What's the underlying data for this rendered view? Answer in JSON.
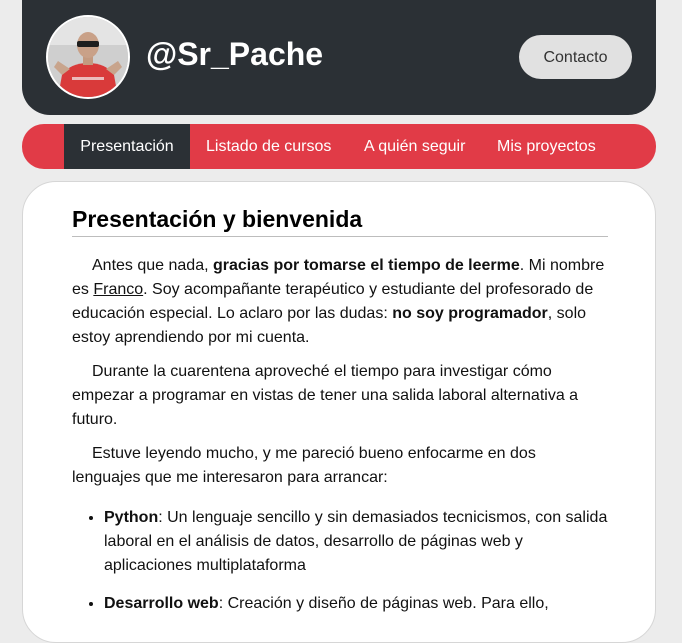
{
  "header": {
    "handle": "@Sr_Pache",
    "contact_label": "Contacto"
  },
  "nav": {
    "items": [
      {
        "label": "Presentación",
        "active": true
      },
      {
        "label": "Listado de cursos",
        "active": false
      },
      {
        "label": "A quién seguir",
        "active": false
      },
      {
        "label": "Mis proyectos",
        "active": false
      }
    ]
  },
  "main": {
    "title": "Presentación y bienvenida",
    "p1": {
      "t1": "Antes que nada, ",
      "b1": "gracias por tomarse el tiempo de leerme",
      "t2": ". Mi nombre es ",
      "link": "Franco",
      "t3": ". Soy acompañante terapéutico y estudiante del profesorado de educación especial. Lo aclaro por las dudas: ",
      "b2": "no soy programador",
      "t4": ", solo estoy aprendiendo por mi cuenta."
    },
    "p2": "Durante la cuarentena aproveché el tiempo para investigar cómo empezar a programar en vistas de tener una salida laboral alternativa a futuro.",
    "p3": "Estuve leyendo mucho, y me pareció bueno enfocarme en dos lenguajes que me interesaron para arrancar:",
    "list": [
      {
        "name": "Python",
        "desc": ": Un lenguaje sencillo y sin demasiados tecnicismos, con salida laboral en el análisis de datos, desarrollo de páginas web y aplicaciones multiplataforma"
      },
      {
        "name": "Desarrollo web",
        "desc": ": Creación y diseño de páginas web. Para ello,"
      }
    ]
  },
  "colors": {
    "header_bg": "#2b3035",
    "nav_bg": "#e13b47",
    "page_bg": "#ececec"
  }
}
